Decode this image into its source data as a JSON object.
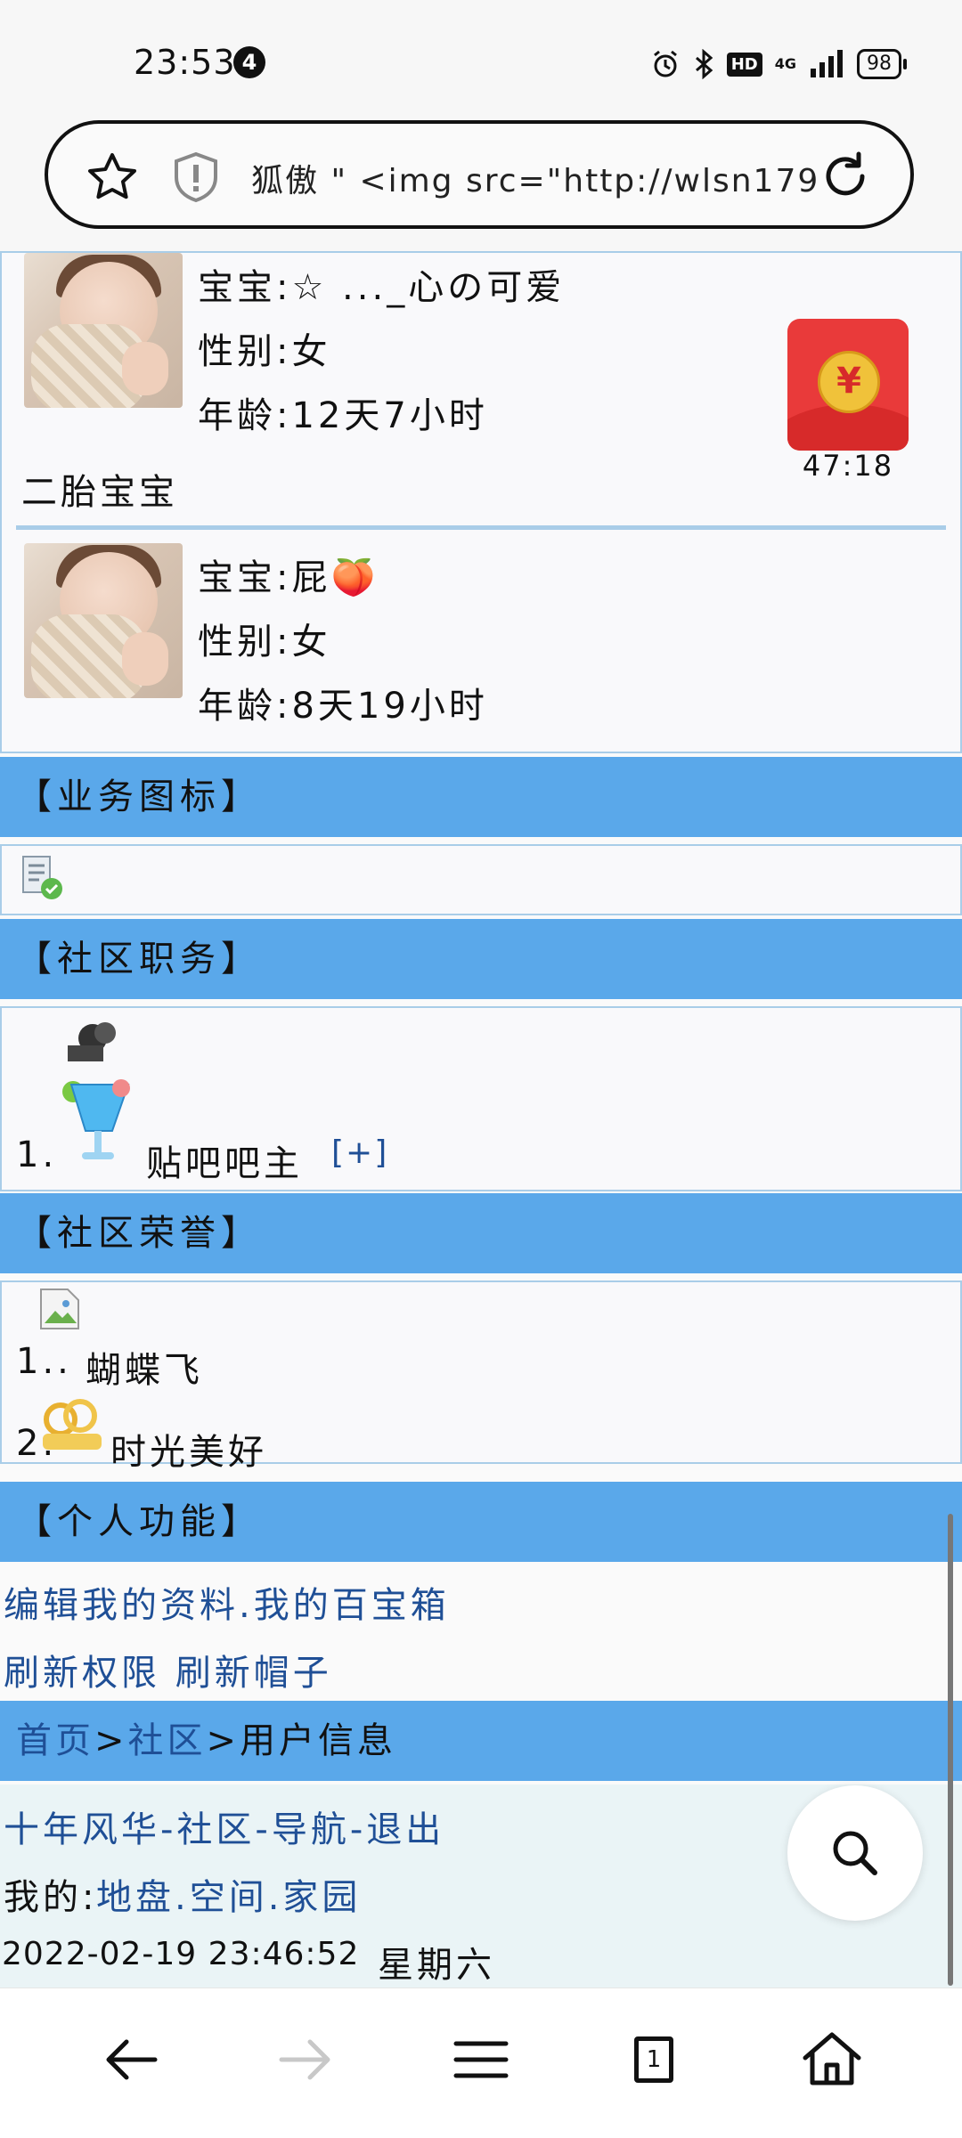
{
  "status_bar": {
    "time": "23:53",
    "notification_count": "4",
    "hd": "HD",
    "network": "4G",
    "battery": "98"
  },
  "url_bar": {
    "text": "狐傲 \" <img src=\"http://wlsn179 ..."
  },
  "babies": [
    {
      "name": "宝宝:☆ ..._心の可爱",
      "gender": "性别:女",
      "age": "年龄:12天7小时",
      "caption": "二胎宝宝"
    },
    {
      "name": "宝宝:屁🍑",
      "gender": "性别:女",
      "age": "年龄:8天19小时"
    }
  ],
  "red_packet": {
    "symbol": "¥",
    "timer": "47:18"
  },
  "sections": {
    "business_icons": "【业务图标】",
    "community_roles": "【社区职务】",
    "community_honors": "【社区荣誉】",
    "personal_functions": "【个人功能】"
  },
  "roles": [
    {
      "index": "1.",
      "title": "贴吧吧主",
      "action": "[+]"
    }
  ],
  "honors": [
    {
      "index": "1..",
      "title": "蝴蝶飞"
    },
    {
      "index": "2.",
      "title": "时光美好"
    }
  ],
  "personal_links": {
    "row1": "编辑我的资料.我的百宝箱",
    "row2": "刷新权限 刷新帽子"
  },
  "breadcrumb": {
    "home": "首页",
    "sep1": ">",
    "community": "社区",
    "sep2": ">",
    "current": "用户信息"
  },
  "footer": {
    "nav_links": "十年风华-社区-导航-退出",
    "mine_label": "我的:",
    "mine_links": "地盘.空间.家园",
    "datetime": "2022-02-19 23:46:52",
    "weekday": "星期六"
  },
  "colors": {
    "header_band": "#5aa8ea",
    "link": "#1f4f96",
    "border": "#a9cde8",
    "red_packet": "#e93a3a"
  },
  "icons": {
    "star": "star-icon",
    "shield": "shield-alert-icon",
    "reload": "reload-icon",
    "search": "search-icon",
    "back": "back-arrow-icon",
    "forward": "forward-arrow-icon",
    "menu": "menu-icon",
    "tabs": "tabs-icon",
    "home": "home-icon"
  },
  "bottom_nav": {
    "tab_count": "1"
  }
}
